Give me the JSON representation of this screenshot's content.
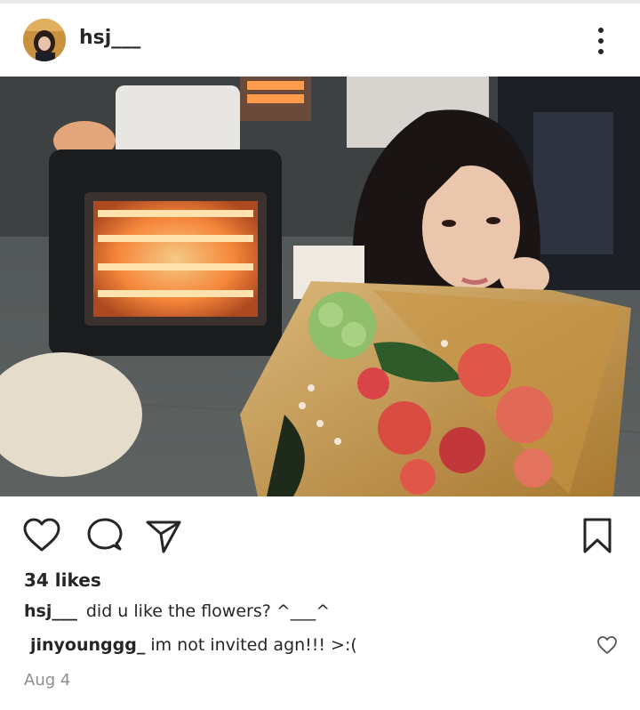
{
  "post": {
    "username": "hsj___",
    "likes": "34 likes",
    "caption": {
      "username": "hsj___",
      "text": "did u like the flowers? ^___^"
    },
    "comments": [
      {
        "username": "jinyounggg_",
        "text": "im not invited agn!!! >:("
      }
    ],
    "date": "Aug 4"
  },
  "icons": {
    "like": "heart-icon",
    "comment": "comment-bubble-icon",
    "share": "paper-plane-icon",
    "save": "bookmark-icon",
    "more": "more-vertical-icon",
    "comment_like": "heart-outline-small-icon"
  },
  "colors": {
    "text": "#262626",
    "muted": "#8e8e8e",
    "background": "#ffffff"
  }
}
